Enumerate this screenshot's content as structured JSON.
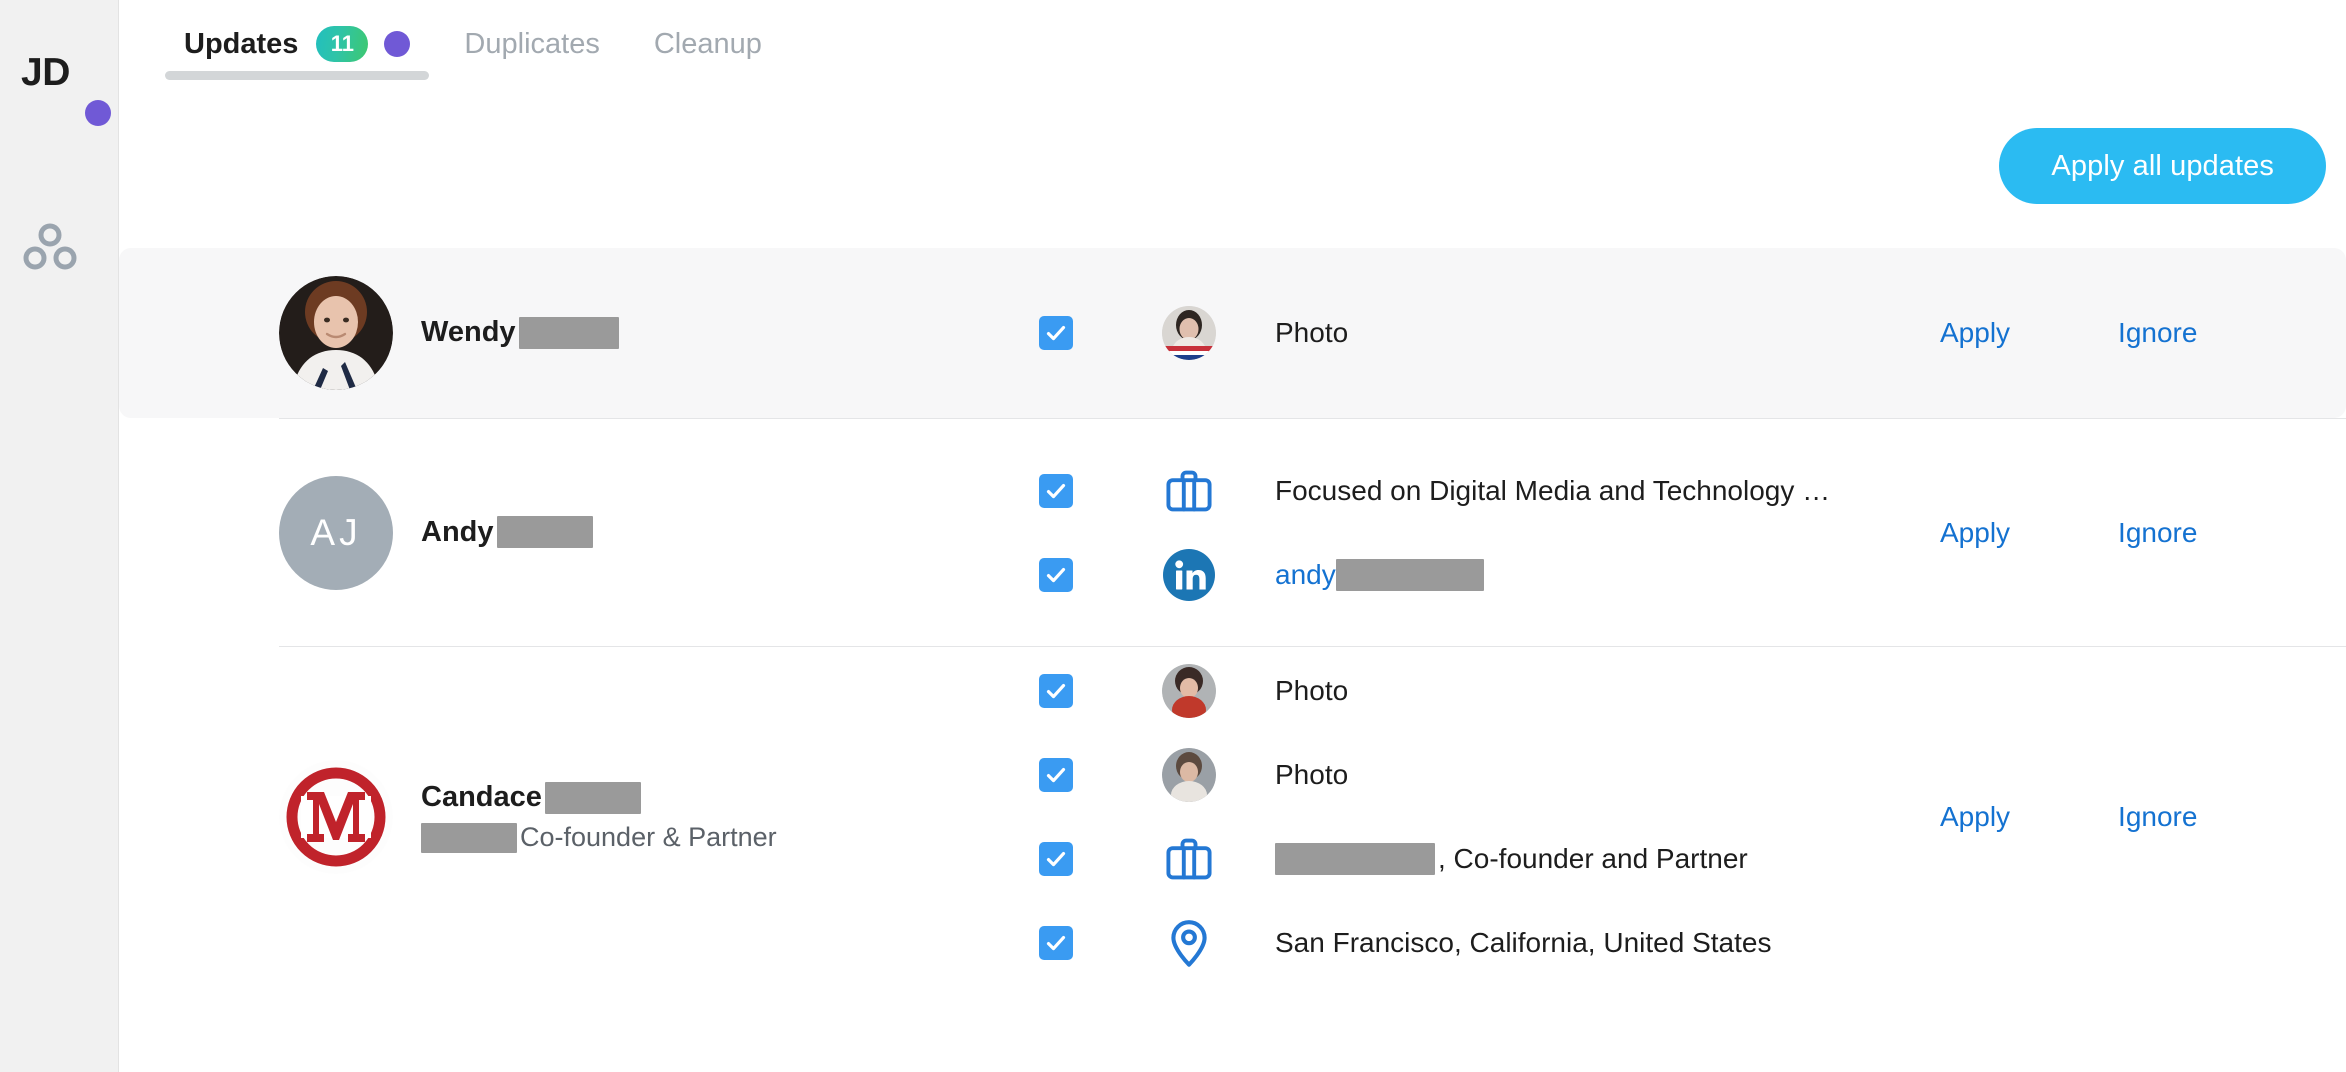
{
  "sidebar": {
    "initials": "JD",
    "badge_color": "#7059d6",
    "group_icon": "people-group-icon"
  },
  "tabs": [
    {
      "label": "Updates",
      "active": true,
      "badge": "11",
      "dot": true
    },
    {
      "label": "Duplicates",
      "active": false,
      "badge": "",
      "dot": false
    },
    {
      "label": "Cleanup",
      "active": false,
      "badge": "",
      "dot": false
    }
  ],
  "toolbar": {
    "apply_all_label": "Apply all updates",
    "apply_all_color": "#2bbbf2"
  },
  "row_actions": {
    "apply_label": "Apply",
    "ignore_label": "Ignore"
  },
  "rows": [
    {
      "highlighted": true,
      "avatar_type": "photo-woman-dark-hair",
      "avatar_initials": "",
      "first_name": "Wendy",
      "name_redacted_width": 100,
      "subtitle_redacted_width": 0,
      "subtitle": "",
      "updates": [
        {
          "checked": true,
          "icon": "photo-thumbnail-icon",
          "text": "Photo",
          "is_link": false,
          "redact_before_width": 0
        }
      ]
    },
    {
      "highlighted": false,
      "avatar_type": "initials",
      "avatar_initials": "AJ",
      "first_name": "Andy",
      "name_redacted_width": 96,
      "subtitle_redacted_width": 0,
      "subtitle": "",
      "updates": [
        {
          "checked": true,
          "icon": "briefcase-icon",
          "text": "Focused on Digital Media and Technology …",
          "is_link": false,
          "redact_before_width": 0
        },
        {
          "checked": true,
          "icon": "linkedin-icon",
          "text": "andy",
          "is_link": true,
          "redact_after_width": 148
        }
      ]
    },
    {
      "highlighted": false,
      "avatar_type": "logo-m-red",
      "avatar_initials": "",
      "first_name": "Candace",
      "name_redacted_width": 96,
      "subtitle_redacted_width": 96,
      "subtitle": "Co-founder & Partner",
      "updates": [
        {
          "checked": true,
          "icon": "photo-thumbnail-icon",
          "text": "Photo",
          "is_link": false,
          "redact_before_width": 0
        },
        {
          "checked": true,
          "icon": "photo-thumbnail-icon-2",
          "text": "Photo",
          "is_link": false,
          "redact_before_width": 0
        },
        {
          "checked": true,
          "icon": "briefcase-icon",
          "text": ", Co-founder and Partner",
          "is_link": false,
          "redact_before_width": 160
        },
        {
          "checked": true,
          "icon": "location-pin-icon",
          "text": "San Francisco, California, United States",
          "is_link": false,
          "redact_before_width": 0
        }
      ]
    }
  ]
}
